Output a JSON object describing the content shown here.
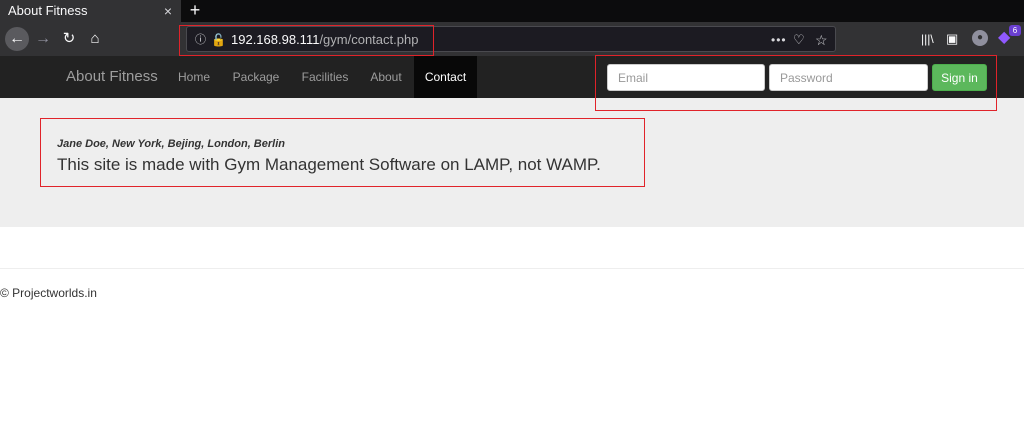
{
  "browser": {
    "tab_title": "About Fitness",
    "tab_close": "×",
    "new_tab": "+",
    "url_host": "192.168.98.111",
    "url_path": "/gym/contact.php",
    "url_more": "•••",
    "extension_badge": "6"
  },
  "site": {
    "brand": "About Fitness",
    "nav": [
      {
        "label": "Home",
        "active": false
      },
      {
        "label": "Package",
        "active": false
      },
      {
        "label": "Facilities",
        "active": false
      },
      {
        "label": "About",
        "active": false
      },
      {
        "label": "Contact",
        "active": true
      }
    ],
    "login": {
      "email_placeholder": "Email",
      "password_placeholder": "Password",
      "signin_label": "Sign in"
    }
  },
  "content": {
    "locations": "Jane Doe, New York, Bejing, London, Berlin",
    "description": "This site is made with Gym Management Software on LAMP, not WAMP."
  },
  "footer": {
    "text": "© Projectworlds.in"
  },
  "colors": {
    "annotation": "#e0232a",
    "signin": "#5cb85c",
    "navbar": "#222222"
  }
}
